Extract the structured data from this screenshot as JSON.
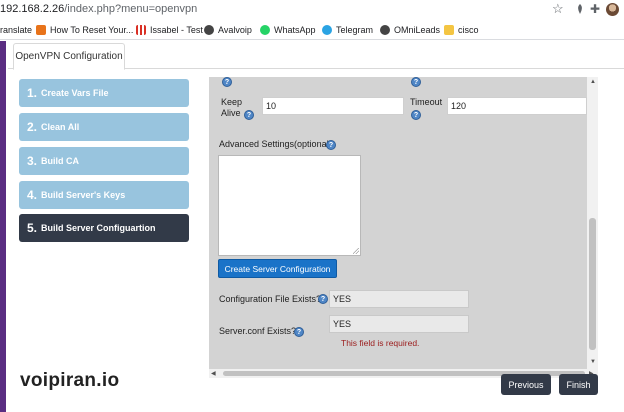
{
  "browser": {
    "url_host": "192.168.2.26",
    "url_path": "/index.php?menu=openvpn",
    "bookmarks": [
      {
        "label": "ranslate",
        "icon": "translate-icon",
        "color": "#4285f4"
      },
      {
        "label": "How To Reset Your...",
        "icon": "bookmark-site-icon",
        "color": "#e8731a"
      },
      {
        "label": "Issabel - Test",
        "icon": "grid-icon",
        "color": "#d93025"
      },
      {
        "label": "Avalvoip",
        "icon": "globe-icon",
        "color": "#444444"
      },
      {
        "label": "WhatsApp",
        "icon": "whatsapp-icon",
        "color": "#25d366"
      },
      {
        "label": "Telegram",
        "icon": "telegram-icon",
        "color": "#2aa3e3"
      },
      {
        "label": "OMniLeads",
        "icon": "globe-icon",
        "color": "#444444"
      },
      {
        "label": "cisco",
        "icon": "folder-icon",
        "color": "#f4c542"
      }
    ]
  },
  "tab": {
    "label": "OpenVPN Configuration"
  },
  "steps": [
    {
      "num": "1.",
      "label": "Create Vars File",
      "active": false
    },
    {
      "num": "2.",
      "label": "Clean All",
      "active": false
    },
    {
      "num": "3.",
      "label": "Build CA",
      "active": false
    },
    {
      "num": "4.",
      "label": "Build Server's Keys",
      "active": false
    },
    {
      "num": "5.",
      "label": "Build Server Configuartion",
      "active": true
    }
  ],
  "form": {
    "keepalive_label_1": "Keep",
    "keepalive_label_2": "Alive",
    "keepalive_value": "10",
    "timeout_label": "Timeout",
    "timeout_value": "120",
    "advanced_label": "Advanced Settings(optional)",
    "advanced_value": "",
    "create_button": "Create Server Configuration",
    "config_exists_label": "Configuration File Exists?",
    "config_exists_value": "YES",
    "serverconf_label": "Server.conf Exists?",
    "serverconf_value": "YES",
    "error_text": "This field is required."
  },
  "watermark": "voipiran.io",
  "nav": {
    "previous": "Previous",
    "finish": "Finish"
  },
  "colors": {
    "step_inactive": "#98c4de",
    "step_active": "#323a48",
    "panel": "#d3d3d3",
    "primary_button": "#1a73c8",
    "error": "#9b1c1c",
    "accent_left_bar": "#5a2d82"
  }
}
